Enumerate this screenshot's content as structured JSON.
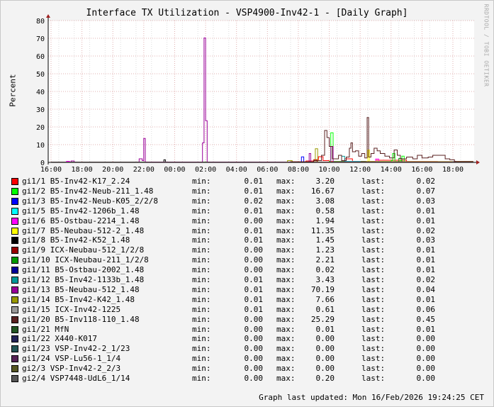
{
  "title": "Interface TX Utilization - VSP4900-Inv42-1 - [Daily Graph]",
  "brand": "RRDTOOL / TOBI OETIKER",
  "footer": "Graph last updated: Mon 16/Feb/2026 19:24:25 CET",
  "legend_labels": {
    "min": "min:",
    "max": "max:",
    "last": "last:"
  },
  "chart_data": {
    "type": "line",
    "title": "Interface TX Utilization - VSP4900-Inv42-1 - [Daily Graph]",
    "ylabel": "Percent",
    "xlabel": "",
    "ylim": [
      0,
      80
    ],
    "yticks": [
      "0",
      "10",
      "20",
      "30",
      "40",
      "50",
      "60",
      "70",
      "80"
    ],
    "xticks": [
      "16:00",
      "18:00",
      "20:00",
      "22:00",
      "00:00",
      "02:00",
      "04:00",
      "06:00",
      "08:00",
      "10:00",
      "12:00",
      "14:00",
      "16:00",
      "18:00"
    ],
    "x_unit": "hours since 16:00",
    "xlim": [
      -0.2,
      27.6
    ],
    "grid": true,
    "series": [
      {
        "name": "gi1/1 B5-Inv42-K17_2.24",
        "color": "#ff0000",
        "min": "0.01",
        "max": "3.20",
        "last": "0.02",
        "points": [
          [
            0,
            0.1
          ],
          [
            15.5,
            0.3
          ],
          [
            16.5,
            0.8
          ],
          [
            17,
            1.5
          ],
          [
            17.3,
            3.2
          ],
          [
            17.6,
            1
          ],
          [
            18,
            0.5
          ],
          [
            19,
            2
          ],
          [
            19.5,
            0.6
          ],
          [
            21,
            1.2
          ],
          [
            23,
            0.5
          ],
          [
            25,
            0.3
          ],
          [
            27.3,
            0.02
          ]
        ]
      },
      {
        "name": "gi1/2 B5-Inv42-Neub-211_1.48",
        "color": "#00ff00",
        "min": "0.01",
        "max": "16.67",
        "last": "0.07",
        "points": [
          [
            0,
            0.1
          ],
          [
            18,
            0.5
          ],
          [
            18.1,
            16.67
          ],
          [
            18.25,
            0.5
          ],
          [
            22,
            1
          ],
          [
            22.1,
            5
          ],
          [
            22.25,
            0.5
          ],
          [
            22.6,
            1
          ],
          [
            22.7,
            3.5
          ],
          [
            22.85,
            0.3
          ],
          [
            27.3,
            0.07
          ]
        ]
      },
      {
        "name": "gi1/3 B5-Inv42-Neub-K05_2/2/8",
        "color": "#0000ff",
        "min": "0.02",
        "max": "3.08",
        "last": "0.03",
        "points": [
          [
            0,
            0.05
          ],
          [
            16.1,
            0.1
          ],
          [
            16.2,
            3.08
          ],
          [
            16.35,
            0.1
          ],
          [
            27.3,
            0.03
          ]
        ]
      },
      {
        "name": "gi1/5 B5-Inv42-1206b_1.48",
        "color": "#00ffff",
        "min": "0.01",
        "max": "0.58",
        "last": "0.01",
        "points": [
          [
            0,
            0.05
          ],
          [
            19,
            0.58
          ],
          [
            20,
            0.2
          ],
          [
            27.3,
            0.01
          ]
        ]
      },
      {
        "name": "gi1/6 B5-Ostbau-2214_1.48",
        "color": "#ff00ff",
        "min": "0.00",
        "max": "1.94",
        "last": "0.01",
        "points": [
          [
            0,
            0
          ],
          [
            1,
            0.6
          ],
          [
            1.2,
            0
          ],
          [
            21,
            1.94
          ],
          [
            21.2,
            0.3
          ],
          [
            27.3,
            0.01
          ]
        ]
      },
      {
        "name": "gi1/7 B5-Neubau-512-2_1.48",
        "color": "#ffff00",
        "min": "0.01",
        "max": "11.35",
        "last": "0.02",
        "points": [
          [
            0,
            0.05
          ],
          [
            20.4,
            0.5
          ],
          [
            20.5,
            7
          ],
          [
            20.6,
            0.5
          ],
          [
            27.3,
            0.02
          ]
        ]
      },
      {
        "name": "gi1/8 B5-Inv42-K52_1.48",
        "color": "#000000",
        "min": "0.01",
        "max": "1.45",
        "last": "0.03",
        "points": [
          [
            0,
            0.05
          ],
          [
            7.3,
            1.45
          ],
          [
            7.4,
            0.05
          ],
          [
            27.3,
            0.03
          ]
        ]
      },
      {
        "name": "gi1/9 ICX-Neubau-512_1/2/8",
        "color": "#990000",
        "min": "0.00",
        "max": "1.23",
        "last": "0.01",
        "points": [
          [
            0,
            0
          ],
          [
            17,
            1.23
          ],
          [
            17.2,
            0
          ],
          [
            27.3,
            0.01
          ]
        ]
      },
      {
        "name": "gi1/10 ICX-Neubau-211_1/2/8",
        "color": "#009900",
        "min": "0.00",
        "max": "2.21",
        "last": "0.01",
        "points": [
          [
            0,
            0
          ],
          [
            22.5,
            2.21
          ],
          [
            22.7,
            0
          ],
          [
            27.3,
            0.01
          ]
        ]
      },
      {
        "name": "gi1/11 B5-Ostbau-2002_1.48",
        "color": "#000099",
        "min": "0.00",
        "max": "0.02",
        "last": "0.01",
        "points": [
          [
            0,
            0
          ],
          [
            27.3,
            0.01
          ]
        ]
      },
      {
        "name": "gi1/12 B5-Inv42-1133b_1.48",
        "color": "#009999",
        "min": "0.01",
        "max": "3.43",
        "last": "0.02",
        "points": [
          [
            0,
            0.05
          ],
          [
            18.8,
            3.43
          ],
          [
            19,
            0.3
          ],
          [
            27.3,
            0.02
          ]
        ]
      },
      {
        "name": "gi1/13 B5-Neubau-512_1.48",
        "color": "#990099",
        "min": "0.01",
        "max": "70.19",
        "last": "0.04",
        "points": [
          [
            0,
            0.1
          ],
          [
            1.3,
            0.8
          ],
          [
            1.5,
            0.1
          ],
          [
            5.7,
            2
          ],
          [
            5.9,
            1
          ],
          [
            6,
            13.5
          ],
          [
            6.1,
            0.2
          ],
          [
            9.7,
            0.2
          ],
          [
            9.8,
            11
          ],
          [
            9.9,
            70.19
          ],
          [
            10.0,
            23.5
          ],
          [
            10.1,
            0.2
          ],
          [
            16.5,
            0.2
          ],
          [
            16.7,
            5
          ],
          [
            16.8,
            0.2
          ],
          [
            18,
            0.2
          ],
          [
            18.1,
            9
          ],
          [
            18.25,
            0.3
          ],
          [
            27.3,
            0.04
          ]
        ]
      },
      {
        "name": "gi1/14 B5-Inv42-K42_1.48",
        "color": "#999900",
        "min": "0.01",
        "max": "7.66",
        "last": "0.01",
        "points": [
          [
            0,
            0.05
          ],
          [
            15.3,
            1
          ],
          [
            15.6,
            0.1
          ],
          [
            17.1,
            7.66
          ],
          [
            17.25,
            0.1
          ],
          [
            27.3,
            0.01
          ]
        ]
      },
      {
        "name": "gi1/15 ICX-Inv42-1225",
        "color": "#999999",
        "min": "0.01",
        "max": "0.61",
        "last": "0.06",
        "points": [
          [
            0,
            0.05
          ],
          [
            26,
            0.61
          ],
          [
            26.2,
            0.05
          ],
          [
            27.3,
            0.06
          ]
        ]
      },
      {
        "name": "gi1/20 B5-Inv118-110_1.48",
        "color": "#5a2020",
        "min": "0.00",
        "max": "25.29",
        "last": "0.45",
        "points": [
          [
            0,
            0
          ],
          [
            15.5,
            0.3
          ],
          [
            17,
            1
          ],
          [
            17.5,
            4
          ],
          [
            17.7,
            18
          ],
          [
            17.85,
            14
          ],
          [
            18,
            9
          ],
          [
            18.2,
            2
          ],
          [
            18.6,
            4
          ],
          [
            18.8,
            1
          ],
          [
            19.1,
            3
          ],
          [
            19.3,
            8
          ],
          [
            19.4,
            11
          ],
          [
            19.5,
            6
          ],
          [
            19.7,
            6.5
          ],
          [
            19.9,
            3.5
          ],
          [
            20.1,
            5
          ],
          [
            20.3,
            2.5
          ],
          [
            20.45,
            25.29
          ],
          [
            20.55,
            3
          ],
          [
            20.7,
            5
          ],
          [
            20.9,
            8
          ],
          [
            21.1,
            6.5
          ],
          [
            21.3,
            5
          ],
          [
            21.6,
            3.5
          ],
          [
            21.9,
            2.5
          ],
          [
            22.2,
            7
          ],
          [
            22.4,
            4
          ],
          [
            22.6,
            2
          ],
          [
            23,
            3
          ],
          [
            23.4,
            2
          ],
          [
            23.7,
            4
          ],
          [
            24,
            2.5
          ],
          [
            24.4,
            3
          ],
          [
            24.7,
            4
          ],
          [
            25.2,
            4
          ],
          [
            25.5,
            2
          ],
          [
            25.8,
            1.5
          ],
          [
            26.1,
            0.5
          ],
          [
            27.3,
            0.45
          ]
        ]
      },
      {
        "name": "gi1/21 MfN",
        "color": "#225522",
        "min": "0.00",
        "max": "0.01",
        "last": "0.01",
        "points": [
          [
            0,
            0
          ],
          [
            27.3,
            0.01
          ]
        ]
      },
      {
        "name": "gi1/22 X440-K017",
        "color": "#222255",
        "min": "0.00",
        "max": "0.00",
        "last": "0.00",
        "points": [
          [
            0,
            0
          ],
          [
            27.3,
            0
          ]
        ]
      },
      {
        "name": "gi1/23 VSP-Inv42-2_1/23",
        "color": "#225555",
        "min": "0.00",
        "max": "0.00",
        "last": "0.00",
        "points": [
          [
            0,
            0
          ],
          [
            27.3,
            0
          ]
        ]
      },
      {
        "name": "gi1/24 VSP-Lu56-1_1/4",
        "color": "#552255",
        "min": "0.00",
        "max": "0.00",
        "last": "0.00",
        "points": [
          [
            0,
            0
          ],
          [
            27.3,
            0
          ]
        ]
      },
      {
        "name": "gi2/3 VSP-Inv42-2_2/3",
        "color": "#555522",
        "min": "0.00",
        "max": "0.00",
        "last": "0.00",
        "points": [
          [
            0,
            0
          ],
          [
            27.3,
            0
          ]
        ]
      },
      {
        "name": "gi2/4 VSP7448-UdL6_1/14",
        "color": "#555555",
        "min": "0.00",
        "max": "0.20",
        "last": "0.00",
        "points": [
          [
            0,
            0
          ],
          [
            27.3,
            0
          ]
        ]
      }
    ]
  }
}
